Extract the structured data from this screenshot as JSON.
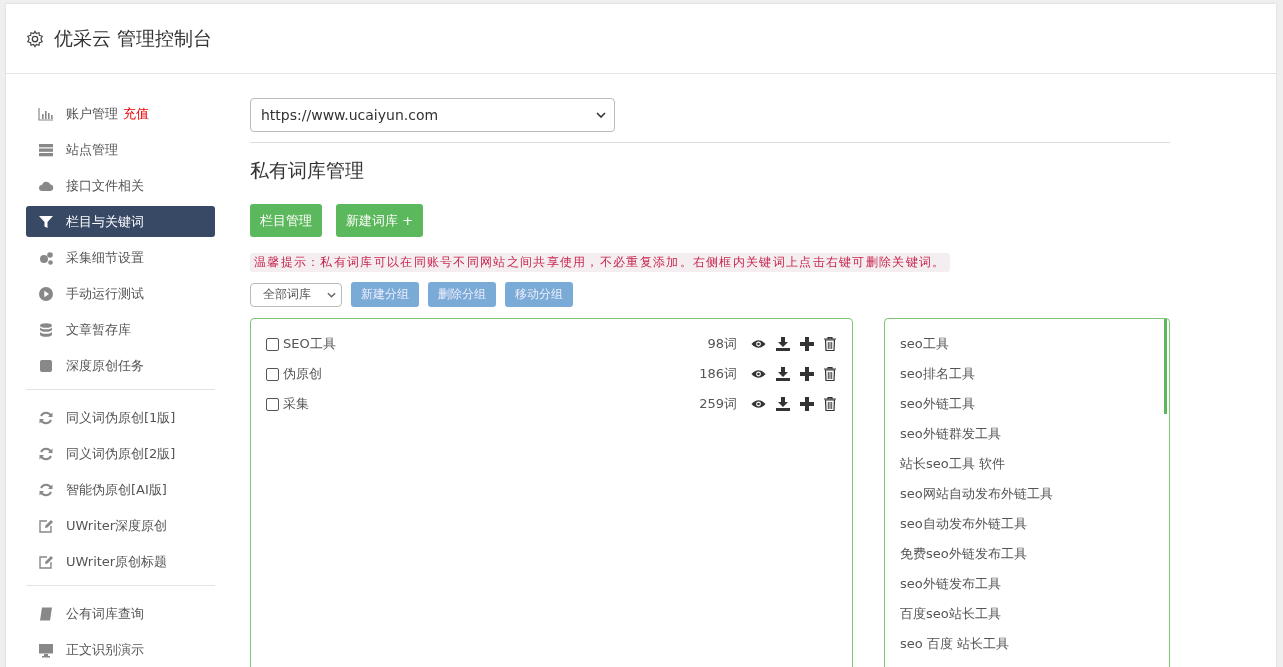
{
  "header": {
    "title": "优采云 管理控制台"
  },
  "sidebar": {
    "groups": [
      [
        {
          "label": "账户管理",
          "badge": "充值",
          "selected": false
        },
        {
          "label": "站点管理",
          "selected": false
        },
        {
          "label": "接口文件相关",
          "selected": false
        },
        {
          "label": "栏目与关键词",
          "selected": true
        },
        {
          "label": "采集细节设置",
          "selected": false
        },
        {
          "label": "手动运行测试",
          "selected": false
        },
        {
          "label": "文章暂存库",
          "selected": false
        },
        {
          "label": "深度原创任务",
          "selected": false
        }
      ],
      [
        {
          "label": "同义词伪原创[1版]",
          "selected": false
        },
        {
          "label": "同义词伪原创[2版]",
          "selected": false
        },
        {
          "label": "智能伪原创[AI版]",
          "selected": false
        },
        {
          "label": "UWriter深度原创",
          "selected": false
        },
        {
          "label": "UWriter原创标题",
          "selected": false
        }
      ],
      [
        {
          "label": "公有词库查询",
          "selected": false
        },
        {
          "label": "正文识别演示",
          "selected": false
        }
      ]
    ]
  },
  "site_select": {
    "value": "https://www.ucaiyun.com"
  },
  "heading": "私有词库管理",
  "buttons": [
    "栏目管理",
    "新建词库 +"
  ],
  "tip": "温馨提示：私有词库可以在同账号不同网站之间共享使用，不必重复添加。右侧框内关键词上点击右键可删除关键词。",
  "group_select": {
    "value": "全部词库"
  },
  "group_buttons": [
    "新建分组",
    "删除分组",
    "移动分组"
  ],
  "libraries": [
    {
      "name": "SEO工具",
      "count": "98词",
      "checked": false
    },
    {
      "name": "伪原创",
      "count": "186词",
      "checked": false
    },
    {
      "name": "采集",
      "count": "259词",
      "checked": false
    }
  ],
  "keywords": [
    "seo工具",
    "seo排名工具",
    "seo外链工具",
    "seo外链群发工具",
    "站长seo工具 软件",
    "seo网站自动发布外链工具",
    "seo自动发布外链工具",
    "免费seo外链发布工具",
    "seo外链发布工具",
    "百度seo站长工具",
    "seo 百度 站长工具"
  ]
}
